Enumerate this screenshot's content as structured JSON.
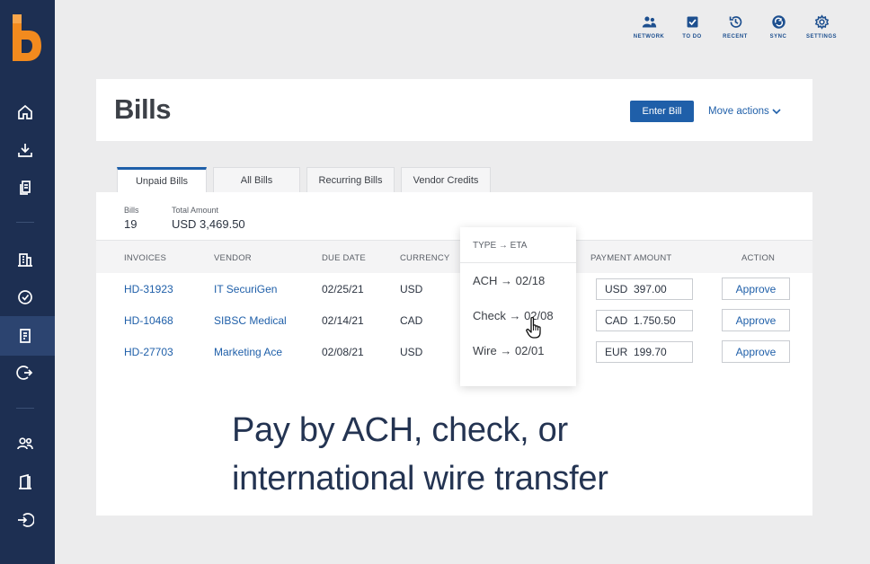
{
  "topnav": [
    {
      "label": "NETWORK",
      "icon": "people-icon"
    },
    {
      "label": "TO DO",
      "icon": "checkbox-icon"
    },
    {
      "label": "RECENT",
      "icon": "history-icon"
    },
    {
      "label": "SYNC",
      "icon": "sync-icon"
    },
    {
      "label": "SETTINGS",
      "icon": "gear-icon"
    }
  ],
  "sidebar": {
    "icons": [
      "home-icon",
      "download-icon",
      "documents-icon",
      "building-icon",
      "check-circle-icon",
      "bill-icon",
      "logout-icon",
      "users-icon",
      "door-icon",
      "login-icon"
    ],
    "active": "bill-icon"
  },
  "header": {
    "title": "Bills",
    "enter_bill": "Enter Bill",
    "move_actions": "Move actions"
  },
  "tabs": [
    "Unpaid Bills",
    "All Bills",
    "Recurring Bills",
    "Vendor Credits"
  ],
  "summary": {
    "bills_label": "Bills",
    "bills_value": "19",
    "total_label": "Total Amount",
    "total_value": "USD 3,469.50"
  },
  "table": {
    "headers": {
      "invoices": "INVOICES",
      "vendor": "VENDOR",
      "due_date": "DUE DATE",
      "currency": "CURRENCY",
      "payment_amount": "PAYMENT AMOUNT",
      "action": "ACTION"
    },
    "rows": [
      {
        "invoice": "HD-31923",
        "vendor": "IT SecuriGen",
        "due": "02/25/21",
        "currency": "USD",
        "amt_cur": "USD",
        "amt_val": "397.00",
        "action": "Approve"
      },
      {
        "invoice": "HD-10468",
        "vendor": "SIBSC Medical",
        "due": "02/14/21",
        "currency": "CAD",
        "amt_cur": "CAD",
        "amt_val": "1.750.50",
        "action": "Approve"
      },
      {
        "invoice": "HD-27703",
        "vendor": "Marketing Ace",
        "due": "02/08/21",
        "currency": "USD",
        "amt_cur": "EUR",
        "amt_val": "199.70",
        "action": "Approve"
      }
    ]
  },
  "dropdown": {
    "header": "TYPE → ETA",
    "items": [
      "ACH → 02/18",
      "Check → 02/08",
      "Wire → 02/01"
    ]
  },
  "tagline": {
    "line1": "Pay by ACH, check, or",
    "line2": "international wire transfer"
  },
  "colors": {
    "sidebar": "#1d2f52",
    "brand_orange": "#f28a1e",
    "primary_blue": "#1f5fa9",
    "tagline": "#243452"
  }
}
